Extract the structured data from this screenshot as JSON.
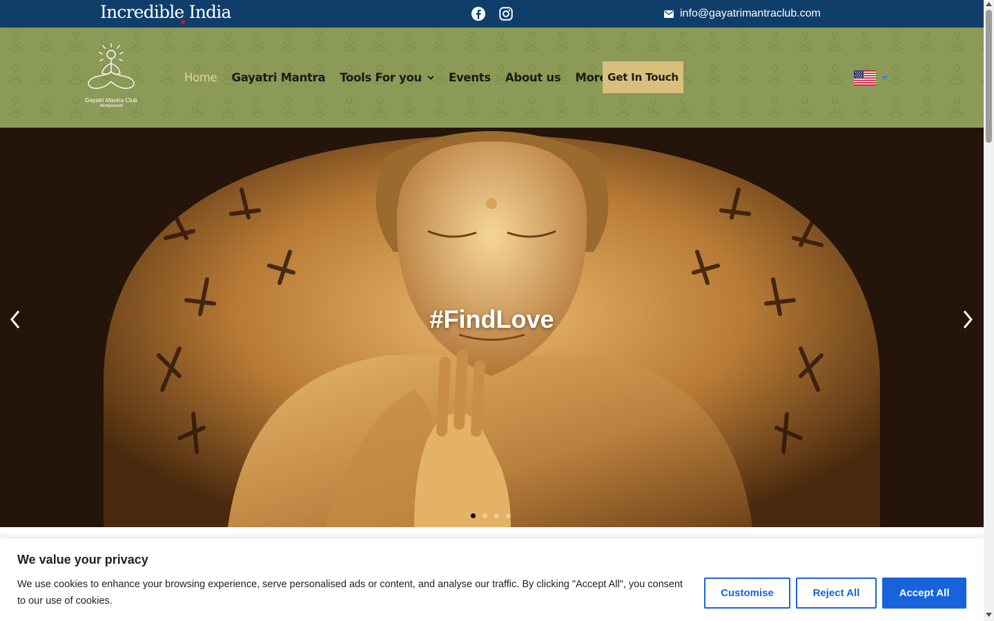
{
  "topbar": {
    "logo_text": "Incredible India",
    "social": [
      "facebook-icon",
      "instagram-icon"
    ],
    "email": "info@gayatrimantraclub.com",
    "background": "#0f3e6b"
  },
  "header": {
    "site_name": "Gayatri Mantra Club",
    "site_tagline": "#findyourself",
    "nav": {
      "home": "Home",
      "gayatri_mantra": "Gayatri Mantra",
      "tools": "Tools For you",
      "events": "Events",
      "about": "About us",
      "more": "More"
    },
    "cta": "Get In Touch",
    "language_flag": "us-flag-icon",
    "background": "#8c9a57",
    "accent": "#d8bf7c"
  },
  "hero": {
    "title": "#FindLove",
    "slides": 4,
    "active_slide": 1
  },
  "cookie": {
    "title": "We value your privacy",
    "text": "We use cookies to enhance your browsing experience, serve personalised ads or content, and analyse our traffic. By clicking \"Accept All\", you consent to our use of cookies.",
    "customise": "Customise",
    "reject": "Reject All",
    "accept": "Accept All",
    "button_color": "#1863dc"
  }
}
